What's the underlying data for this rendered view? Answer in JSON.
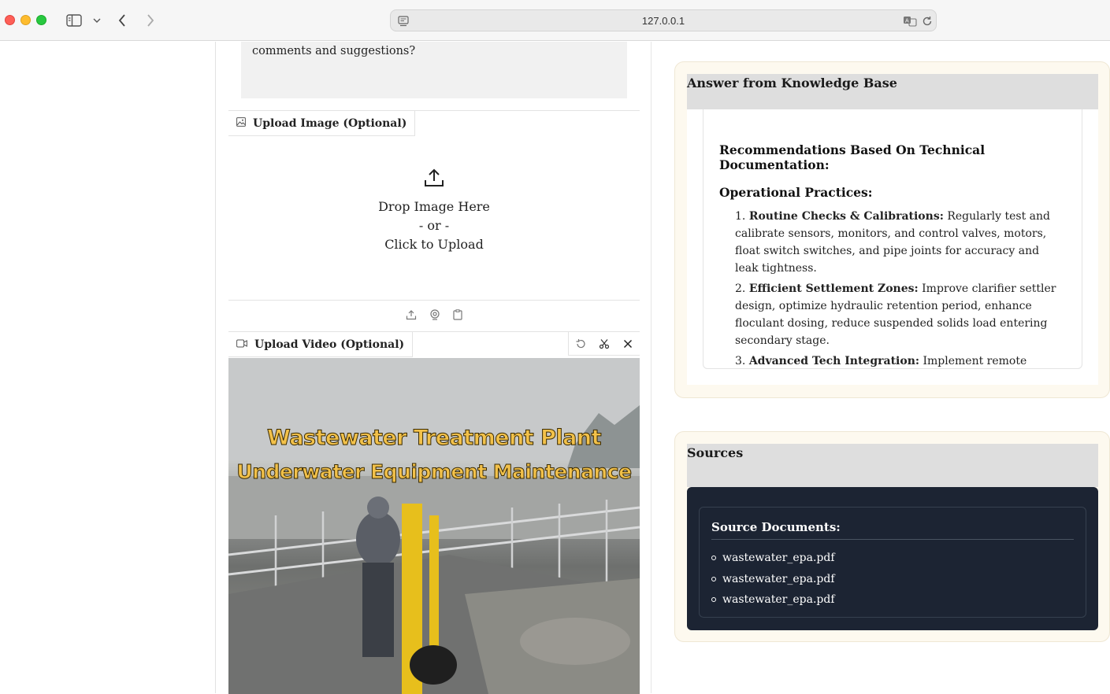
{
  "browser": {
    "url": "127.0.0.1"
  },
  "question": {
    "text_partial": "comments and suggestions?"
  },
  "upload_image": {
    "label": "Upload Image (Optional)",
    "drop_text": "Drop Image Here",
    "or_text": "- or -",
    "click_text": "Click to Upload"
  },
  "upload_video": {
    "label": "Upload Video (Optional)",
    "caption_line1": "Wastewater Treatment Plant",
    "caption_line2": "Underwater Equipment Maintenance"
  },
  "answer": {
    "panel_title": "Answer from Knowledge Base",
    "heading": "Recommendations Based On Technical Documentation:",
    "subheading": "Operational Practices:",
    "items": [
      {
        "num": "1.",
        "title": "Routine Checks & Calibrations:",
        "text": " Regularly test and calibrate sensors, monitors, and control valves, motors, float switch switches, and pipe joints for accuracy and leak tightness."
      },
      {
        "num": "2.",
        "title": "Efficient Settlement Zones:",
        "text": " Improve clarifier settler design, optimize hydraulic retention period, enhance floculant dosing, reduce suspended solids load entering secondary stage."
      },
      {
        "num": "3.",
        "title": "Advanced Tech Integration:",
        "text": " Implement remote sensing, AI analytics, IoT enabled smart grid controls, predictive maintenance software, automated alerts, telemetric panel logging, mobile apps for operators."
      }
    ]
  },
  "sources": {
    "panel_title": "Sources",
    "heading": "Source Documents:",
    "items": [
      "wastewater_epa.pdf",
      "wastewater_epa.pdf",
      "wastewater_epa.pdf"
    ]
  },
  "colors": {
    "panel_bg": "#fdf9ef",
    "sources_bg": "#1c2433",
    "caption": "#f2c14a"
  }
}
